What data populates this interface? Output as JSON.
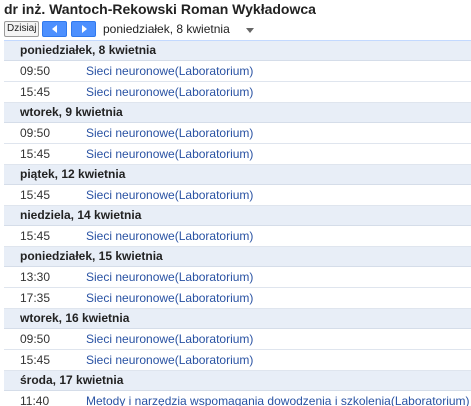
{
  "header": {
    "title": "dr inż. Wantoch-Rekowski Roman Wykładowca"
  },
  "toolbar": {
    "today_label": "Dzisiaj",
    "date_label": "poniedziałek, 8 kwietnia"
  },
  "days": [
    {
      "label": "poniedziałek, 8 kwietnia",
      "events": [
        {
          "time": "09:50",
          "title": "Sieci neuronowe(Laboratorium)"
        },
        {
          "time": "15:45",
          "title": "Sieci neuronowe(Laboratorium)"
        }
      ]
    },
    {
      "label": "wtorek, 9 kwietnia",
      "events": [
        {
          "time": "09:50",
          "title": "Sieci neuronowe(Laboratorium)"
        },
        {
          "time": "15:45",
          "title": "Sieci neuronowe(Laboratorium)"
        }
      ]
    },
    {
      "label": "piątek, 12 kwietnia",
      "events": [
        {
          "time": "15:45",
          "title": "Sieci neuronowe(Laboratorium)"
        }
      ]
    },
    {
      "label": "niedziela, 14 kwietnia",
      "events": [
        {
          "time": "15:45",
          "title": "Sieci neuronowe(Laboratorium)"
        }
      ]
    },
    {
      "label": "poniedziałek, 15 kwietnia",
      "events": [
        {
          "time": "13:30",
          "title": "Sieci neuronowe(Laboratorium)"
        },
        {
          "time": "17:35",
          "title": "Sieci neuronowe(Laboratorium)"
        }
      ]
    },
    {
      "label": "wtorek, 16 kwietnia",
      "events": [
        {
          "time": "09:50",
          "title": "Sieci neuronowe(Laboratorium)"
        },
        {
          "time": "15:45",
          "title": "Sieci neuronowe(Laboratorium)"
        }
      ]
    },
    {
      "label": "środa, 17 kwietnia",
      "events": [
        {
          "time": "11:40",
          "title": "Metody i narzędzia wspomagania dowodzenia i szkolenia(Laboratorium)"
        }
      ]
    }
  ]
}
